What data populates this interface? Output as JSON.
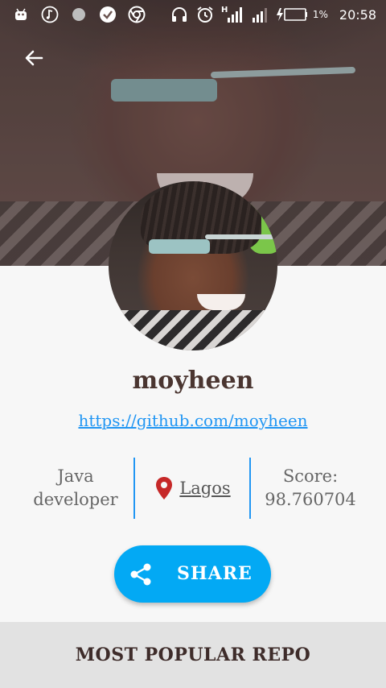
{
  "status_bar": {
    "left_icons": [
      "android-icon",
      "music-note-icon",
      "dot-icon",
      "check-circle-icon",
      "chrome-icon"
    ],
    "right_icons": [
      "headphones-icon",
      "alarm-icon",
      "signal-h-icon",
      "signal-icon",
      "battery-charging-icon"
    ],
    "h_label": "H",
    "battery": "1%",
    "time": "20:58"
  },
  "navigation": {
    "back_icon": "arrow-back-icon"
  },
  "profile": {
    "username": "moyheen",
    "github_url": "https://github.com/moyheen",
    "role": "Java developer",
    "location": "Lagos",
    "score_label": "Score:",
    "score_value": "98.760704"
  },
  "actions": {
    "share_label": "SHARE",
    "share_icon": "share-icon"
  },
  "section": {
    "title": "MOST POPULAR REPO"
  },
  "colors": {
    "accent": "#03a9f4",
    "link": "#2196f3",
    "location_pin": "#c62828",
    "name_text": "#4a3530",
    "section_bg": "#e2e2e2"
  }
}
